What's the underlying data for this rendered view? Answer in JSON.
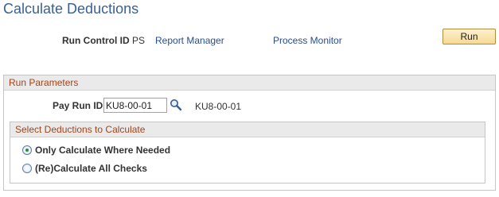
{
  "page": {
    "title": "Calculate Deductions"
  },
  "toolbar": {
    "run_control_label": "Run Control ID",
    "run_control_value": "PS",
    "report_manager_link": "Report Manager",
    "process_monitor_link": "Process Monitor",
    "run_button_label": "Run"
  },
  "run_parameters": {
    "group_title": "Run Parameters",
    "pay_run_label": "Pay Run ID",
    "pay_run_value": "KU8-00-01",
    "pay_run_description": "KU8-00-01",
    "lookup_icon": "magnifier-icon"
  },
  "deductions": {
    "group_title": "Select Deductions to Calculate",
    "options": [
      {
        "label": "Only Calculate Where Needed",
        "selected": true
      },
      {
        "label": "(Re)Calculate All Checks",
        "selected": false
      }
    ]
  },
  "colors": {
    "title": "#3a6093",
    "link": "#254e8f",
    "group_title": "#a84318",
    "radio_selected": "#2e8b3a",
    "button_fill": "#f7d990"
  }
}
